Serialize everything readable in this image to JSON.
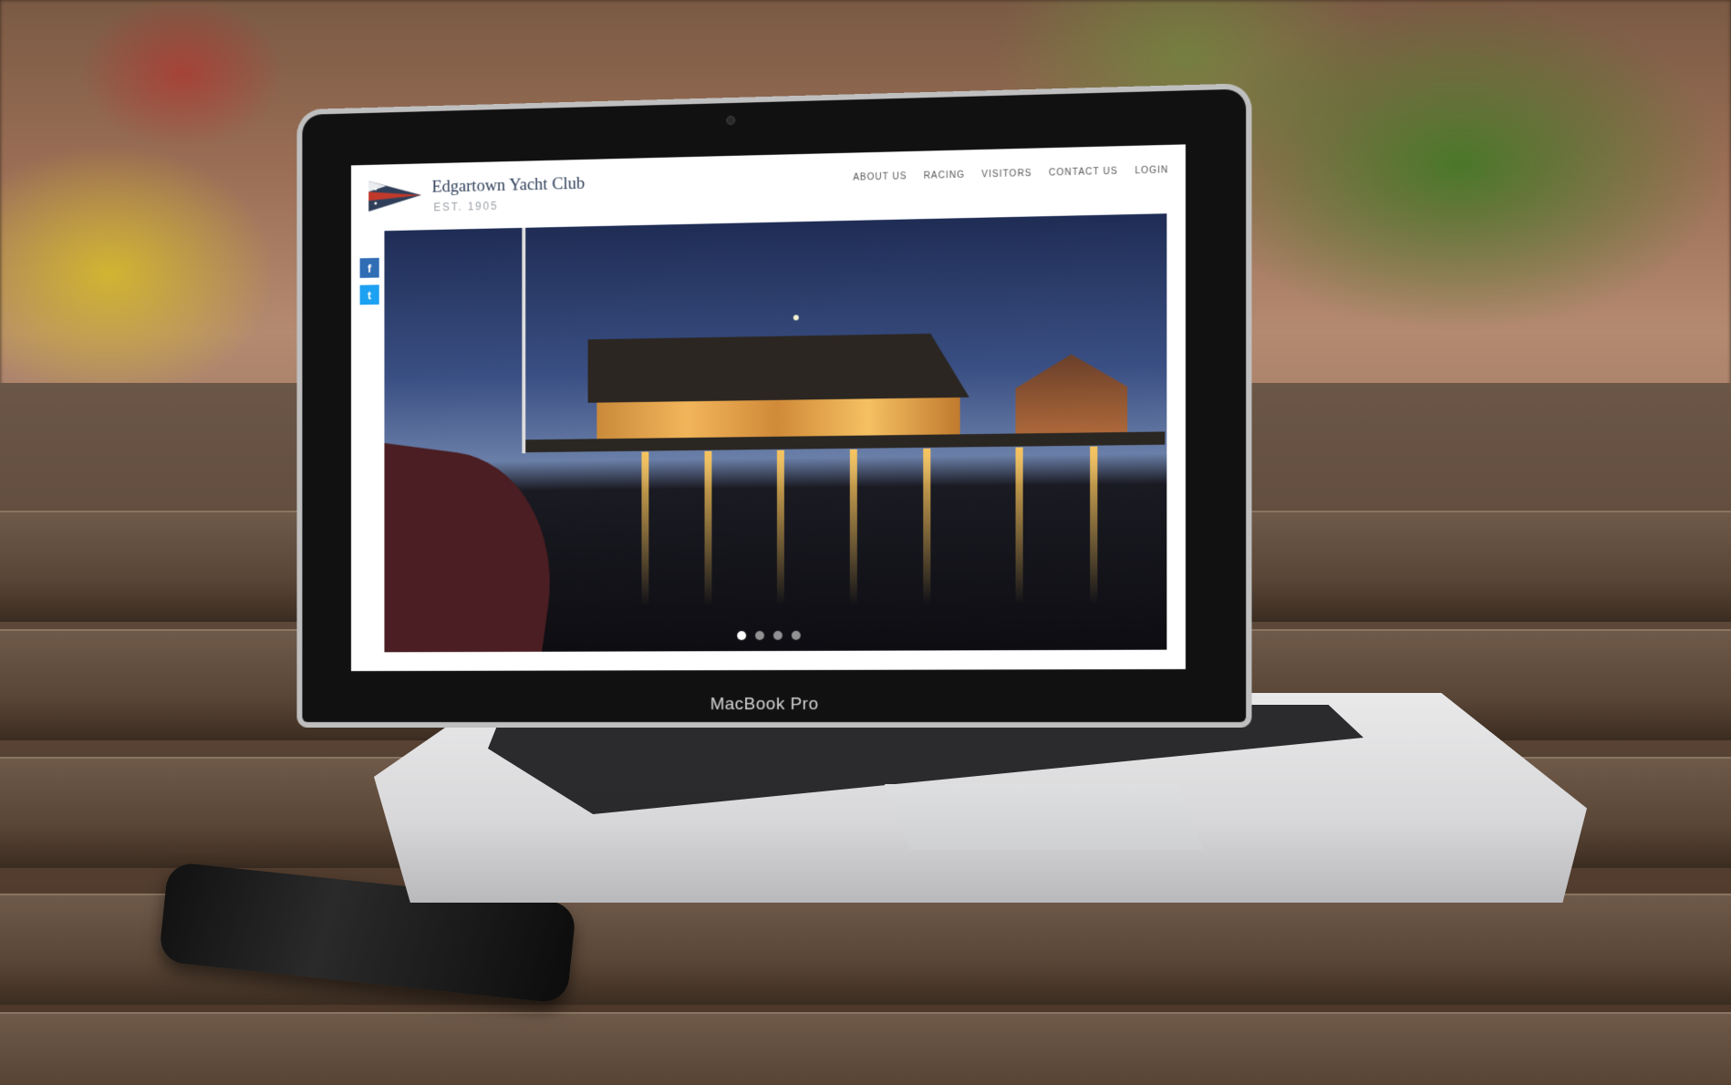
{
  "site": {
    "brand_name": "Edgartown Yacht Club",
    "brand_est": "EST. 1905",
    "nav": [
      "ABOUT US",
      "RACING",
      "VISITORS",
      "CONTACT US",
      "LOGIN"
    ],
    "social": [
      {
        "icon": "facebook-icon",
        "glyph": "f"
      },
      {
        "icon": "twitter-icon",
        "glyph": "t"
      }
    ],
    "slider": {
      "total": 4,
      "active": 1
    }
  },
  "device": {
    "label": "MacBook Pro"
  },
  "colors": {
    "brand": "#2f3f5a",
    "flag_red": "#c0392b",
    "facebook": "#2f6db5",
    "twitter": "#1da1f2"
  }
}
